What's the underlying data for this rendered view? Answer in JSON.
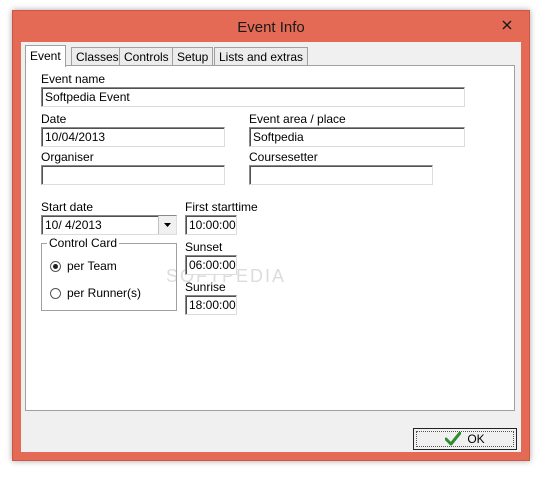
{
  "window": {
    "title": "Event Info"
  },
  "tabs": [
    {
      "label": "Event"
    },
    {
      "label": "Classes"
    },
    {
      "label": "Controls"
    },
    {
      "label": "Setup"
    },
    {
      "label": "Lists and extras"
    }
  ],
  "event": {
    "event_name_label": "Event name",
    "event_name_value": "Softpedia Event",
    "date_label": "Date",
    "date_value": "10/04/2013",
    "event_area_label": "Event area / place",
    "event_area_value": "Softpedia",
    "organiser_label": "Organiser",
    "organiser_value": "",
    "coursesetter_label": "Coursesetter",
    "coursesetter_value": "",
    "start_date_label": "Start date",
    "start_date_value": "10/  4/2013",
    "first_starttime_label": "First starttime",
    "first_starttime_value": "10:00:00",
    "sunset_label": "Sunset",
    "sunset_value": "06:00:00",
    "sunrise_label": "Sunrise",
    "sunrise_value": "18:00:00",
    "control_card": {
      "title": "Control Card",
      "options": [
        {
          "label": "per Team",
          "selected": true
        },
        {
          "label": "per Runner(s)",
          "selected": false
        }
      ]
    }
  },
  "footer": {
    "ok_label": "OK"
  },
  "watermark": "SOFTPEDIA"
}
